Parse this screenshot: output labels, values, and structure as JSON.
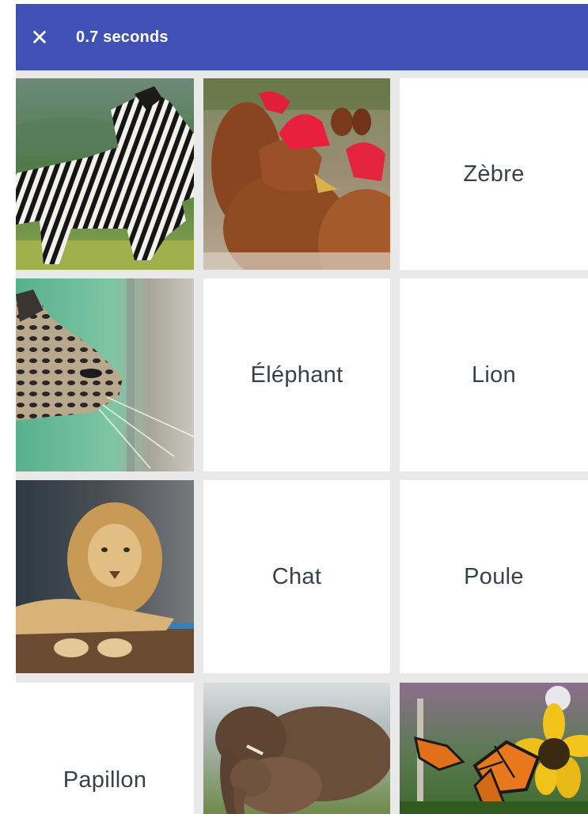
{
  "header": {
    "close_icon": "close-icon",
    "timer_text": "0.7 seconds",
    "background": "#3f51b5"
  },
  "grid": {
    "words": {
      "zebre": "Zèbre",
      "elephant": "Éléphant",
      "lion": "Lion",
      "chat": "Chat",
      "poule": "Poule",
      "papillon": "Papillon"
    },
    "images": [
      "zebra-photo",
      "hens-photo",
      "cat-photo",
      "lion-photo",
      "elephant-photo",
      "butterfly-photo"
    ]
  }
}
